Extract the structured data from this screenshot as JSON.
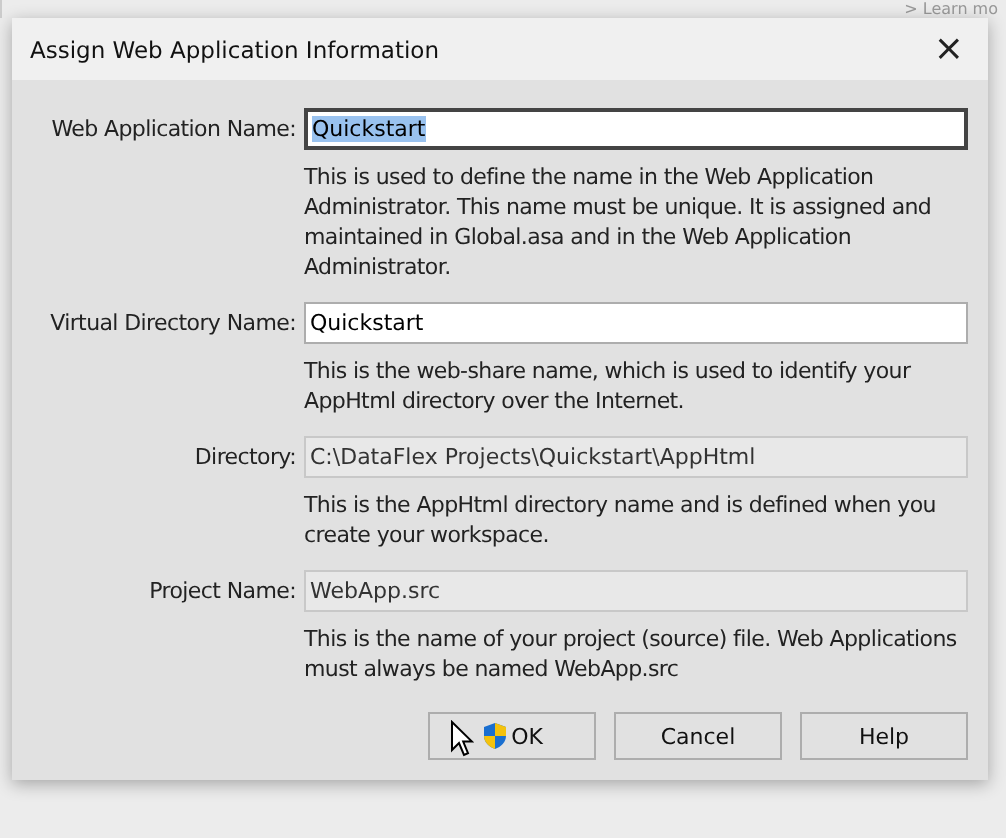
{
  "background": {
    "link": "> Learn mo"
  },
  "window": {
    "title": "Assign Web Application Information",
    "close": "×"
  },
  "fields": [
    {
      "label": "Web Application Name:",
      "value": "Quickstart",
      "focused": true,
      "disabled": false,
      "description": "This is used to define the name in the Web Application Administrator. This name must be unique. It is assigned and maintained in Global.asa and in the Web Application Administrator."
    },
    {
      "label": "Virtual Directory Name:",
      "value": "Quickstart",
      "focused": false,
      "disabled": false,
      "description": "This is the web-share name, which is used to identify your AppHtml directory over the Internet."
    },
    {
      "label": "Directory:",
      "value": "C:\\DataFlex Projects\\Quickstart\\AppHtml",
      "focused": false,
      "disabled": true,
      "description": "This is the AppHtml directory name and is defined when you create your workspace."
    },
    {
      "label": "Project Name:",
      "value": "WebApp.src",
      "focused": false,
      "disabled": true,
      "description": "This is the name of your project (source) file. Web Applications must always be named WebApp.src"
    }
  ],
  "buttons": [
    {
      "label": "OK",
      "shield": true
    },
    {
      "label": "Cancel",
      "shield": false
    },
    {
      "label": "Help",
      "shield": false
    }
  ]
}
